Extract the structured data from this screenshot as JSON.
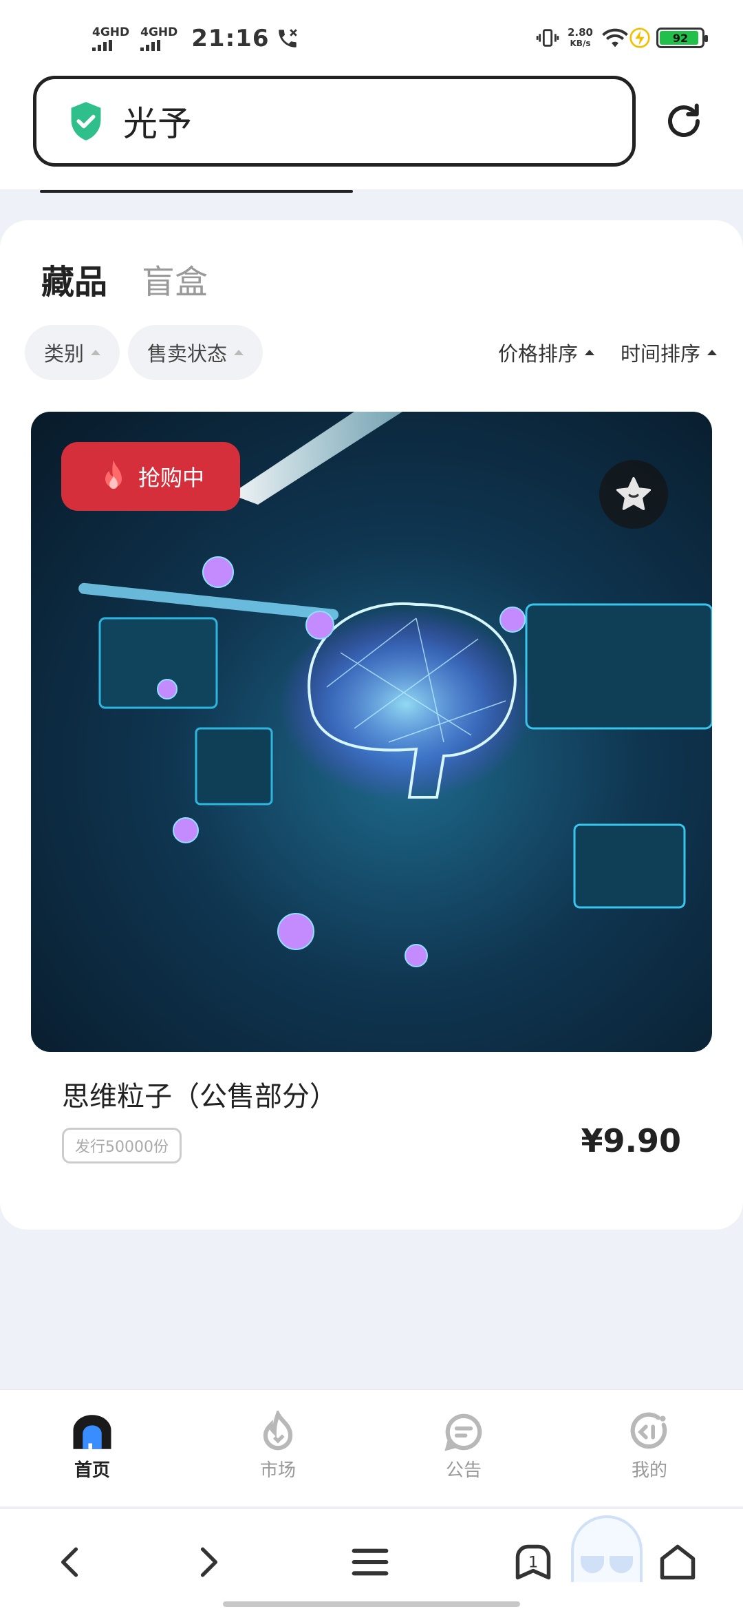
{
  "status_bar": {
    "net1": "4GHD",
    "net2": "4GHD",
    "time": "21:16",
    "speed_value": "2.80",
    "speed_unit": "KB/s",
    "battery": "92"
  },
  "address_bar": {
    "text": "光予"
  },
  "tabs": [
    {
      "label": "藏品"
    },
    {
      "label": "盲盒"
    }
  ],
  "filters": {
    "category": "类别",
    "sale_status": "售卖状态",
    "price_sort": "价格排序",
    "time_sort": "时间排序"
  },
  "product": {
    "badge": "抢购中",
    "title": "思维粒子（公售部分）",
    "issue": "发行50000份",
    "price": "¥9.90"
  },
  "bottom_nav": [
    {
      "label": "首页"
    },
    {
      "label": "市场"
    },
    {
      "label": "公告"
    },
    {
      "label": "我的"
    }
  ],
  "browser": {
    "tab_count": "1"
  },
  "colors": {
    "accent_red": "#d42f3a",
    "shield_green": "#2fbf8a",
    "battery_green": "#22c04a"
  }
}
